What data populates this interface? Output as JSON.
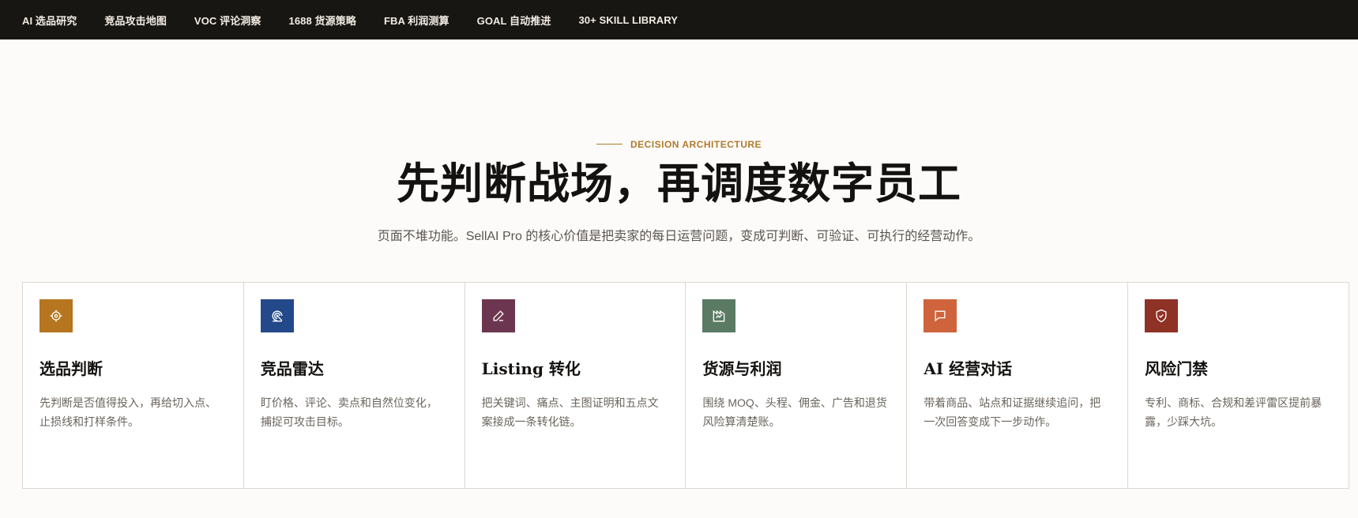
{
  "nav": {
    "items": [
      {
        "label": "AI 选品研究"
      },
      {
        "label": "竞品攻击地图"
      },
      {
        "label": "VOC 评论洞察"
      },
      {
        "label": "1688 货源策略"
      },
      {
        "label": "FBA 利润测算"
      },
      {
        "label": "GOAL 自动推进"
      },
      {
        "label": "30+ SKILL LIBRARY"
      }
    ]
  },
  "hero": {
    "eyebrow": "DECISION ARCHITECTURE",
    "headline": "先判断战场，再调度数字员工",
    "subtitle": "页面不堆功能。SellAI Pro 的核心价值是把卖家的每日运营问题，变成可判断、可验证、可执行的经营动作。"
  },
  "cards": [
    {
      "icon": "target-icon",
      "color": "#b5761f",
      "title": "选品判断",
      "desc_1": "先判断是否值得投入，再给切入点、",
      "desc_2": "止损线和打样条件。"
    },
    {
      "icon": "radar-icon",
      "color": "#24498a",
      "title": "竞品雷达",
      "desc_1": "盯价格、评论、卖点和自然位变化，",
      "desc_2": "捕捉可攻击目标。"
    },
    {
      "icon": "pen-icon",
      "color": "#6d3650",
      "title": "Listing 转化",
      "desc_1": "把关键词、痛点、主图证明和五点文",
      "desc_2": "案接成一条转化链。"
    },
    {
      "icon": "factory-icon",
      "color": "#5a7a63",
      "title": "货源与利润",
      "desc_1": "围绕 MOQ、头程、佣金、广告和退货",
      "desc_2": "风险算清楚账。"
    },
    {
      "icon": "chat-icon",
      "color": "#cf633c",
      "title": "AI 经营对话",
      "desc_1": "带着商品、站点和证据继续追问，把",
      "desc_2": "一次回答变成下一步动作。"
    },
    {
      "icon": "shield-check-icon",
      "color": "#8e3225",
      "title": "风险门禁",
      "desc_1": "专利、商标、合规和差评雷区提前暴",
      "desc_2": "露，少踩大坑。"
    }
  ]
}
